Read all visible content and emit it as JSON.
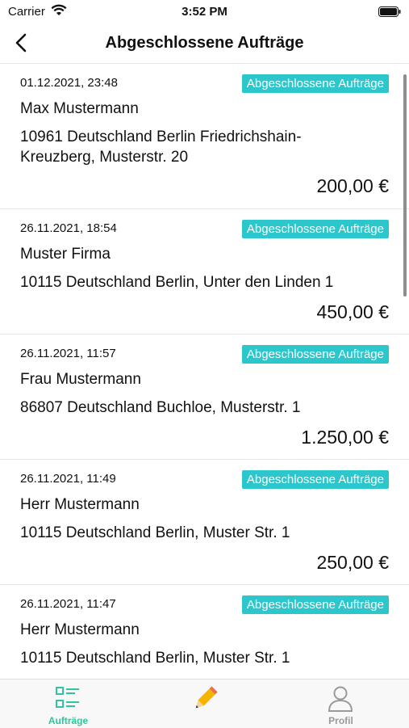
{
  "status_bar": {
    "carrier": "Carrier",
    "time": "3:52 PM"
  },
  "nav": {
    "title": "Abgeschlossene Aufträge"
  },
  "orders": [
    {
      "date": "01.12.2021, 23:48",
      "badge": "Abgeschlossene Aufträge",
      "name": "Max  Mustermann",
      "address": "10961 Deutschland Berlin Friedrichshain-Kreuzberg, Musterstr.  20",
      "price": "200,00 €"
    },
    {
      "date": "26.11.2021, 18:54",
      "badge": "Abgeschlossene Aufträge",
      "name": "Muster Firma",
      "address": "10115 Deutschland Berlin, Unter den Linden 1",
      "price": "450,00 €"
    },
    {
      "date": "26.11.2021, 11:57",
      "badge": "Abgeschlossene Aufträge",
      "name": "Frau Mustermann",
      "address": "86807 Deutschland Buchloe, Musterstr.  1",
      "price": "1.250,00 €"
    },
    {
      "date": "26.11.2021, 11:49",
      "badge": "Abgeschlossene Aufträge",
      "name": "Herr Mustermann",
      "address": "10115 Deutschland Berlin, Muster Str. 1",
      "price": "250,00 €"
    },
    {
      "date": "26.11.2021, 11:47",
      "badge": "Abgeschlossene Aufträge",
      "name": "Herr Mustermann",
      "address": "10115 Deutschland Berlin, Muster Str.  1",
      "price": ""
    }
  ],
  "tab_bar": {
    "tabs": [
      {
        "label": "Aufträge",
        "icon": "orders-list-icon",
        "active": true
      },
      {
        "label": "",
        "icon": "pencil-icon",
        "active": false
      },
      {
        "label": "Profil",
        "icon": "profile-icon",
        "active": false
      }
    ]
  },
  "colors": {
    "accent": "#2cc7cc",
    "active_tab": "#2cc7a0",
    "inactive_tab": "#9a9a9a",
    "pencil": "#f5b400"
  }
}
